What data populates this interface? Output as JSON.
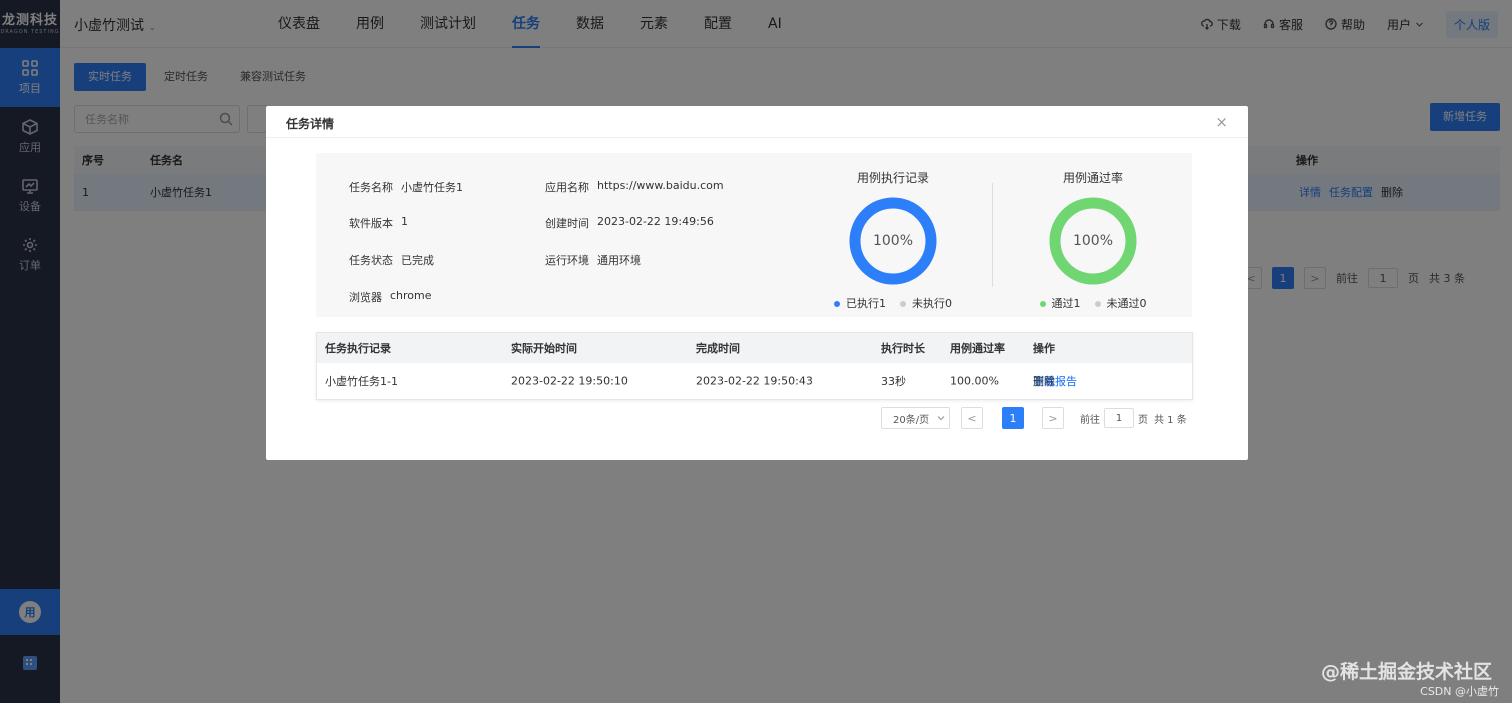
{
  "sidebar": {
    "logo_main": "龙测科技",
    "logo_sub": "DRAGON TESTING",
    "items": [
      {
        "label": "项目",
        "icon": "grid-icon"
      },
      {
        "label": "应用",
        "icon": "cube-icon"
      },
      {
        "label": "设备",
        "icon": "monitor-icon"
      },
      {
        "label": "订单",
        "icon": "gear-icon"
      }
    ],
    "bottom_avatar": "用",
    "bottom_icon": "building-icon"
  },
  "topbar": {
    "project": "小虚竹测试",
    "nav": [
      "仪表盘",
      "用例",
      "测试计划",
      "任务",
      "数据",
      "元素",
      "配置",
      "AI"
    ],
    "active_nav": "任务",
    "download": "下载",
    "service": "客服",
    "help": "帮助",
    "user": "用户",
    "personal": "个人版"
  },
  "page": {
    "tabs": [
      "实时任务",
      "定时任务",
      "兼容测试任务"
    ],
    "search_placeholder": "任务名称",
    "new_task": "新增任务",
    "table_headers": {
      "index": "序号",
      "name": "任务名",
      "ops": "操作"
    },
    "row": {
      "index": "1",
      "name": "小虚竹任务1",
      "op_detail": "详情",
      "op_config": "任务配置",
      "op_delete": "删除"
    },
    "pager": {
      "prev": "<",
      "current": "1",
      "next": ">",
      "goto": "前往",
      "page_input": "1",
      "page_unit": "页",
      "total": "共 3 条"
    }
  },
  "modal": {
    "title": "任务详情",
    "close": "×",
    "info": {
      "task_name_label": "任务名称",
      "task_name": "小虚竹任务1",
      "software_version_label": "软件版本",
      "software_version": "1",
      "task_status_label": "任务状态",
      "task_status": "已完成",
      "browser_label": "浏览器",
      "browser": "chrome",
      "app_name_label": "应用名称",
      "app_name": "https://www.baidu.com",
      "created_label": "创建时间",
      "created": "2023-02-22 19:49:56",
      "env_label": "运行环境",
      "env": "通用环境"
    },
    "charts": [
      {
        "title": "用例执行记录",
        "percent": "100%",
        "fraction": 1.0,
        "color": "#2d7ff9",
        "legend": [
          {
            "label": "已执行1",
            "color": "#2d7ff9"
          },
          {
            "label": "未执行0",
            "color": "#cccccc"
          }
        ]
      },
      {
        "title": "用例通过率",
        "percent": "100%",
        "fraction": 1.0,
        "color": "#6fd672",
        "legend": [
          {
            "label": "通过1",
            "color": "#6fd672"
          },
          {
            "label": "未通过0",
            "color": "#cccccc"
          }
        ]
      }
    ],
    "records": {
      "headers": [
        "任务执行记录",
        "实际开始时间",
        "完成时间",
        "执行时长",
        "用例通过率",
        "操作"
      ],
      "rows": [
        {
          "record": "小虚竹任务1-1",
          "start": "2023-02-22 19:50:10",
          "end": "2023-02-22 19:50:43",
          "duration": "33秒",
          "pass_rate": "100.00%",
          "op_view": "查看报告",
          "op_download": "下载报告",
          "op_delete": "删除"
        }
      ]
    },
    "pager": {
      "page_size": "20条/页",
      "prev": "<",
      "current": "1",
      "next": ">",
      "goto": "前往",
      "page_input": "1",
      "page_unit": "页",
      "total": "共 1 条"
    }
  },
  "watermark": {
    "text": "@稀土掘金技术社区",
    "csdn": "CSDN @小虚竹"
  }
}
